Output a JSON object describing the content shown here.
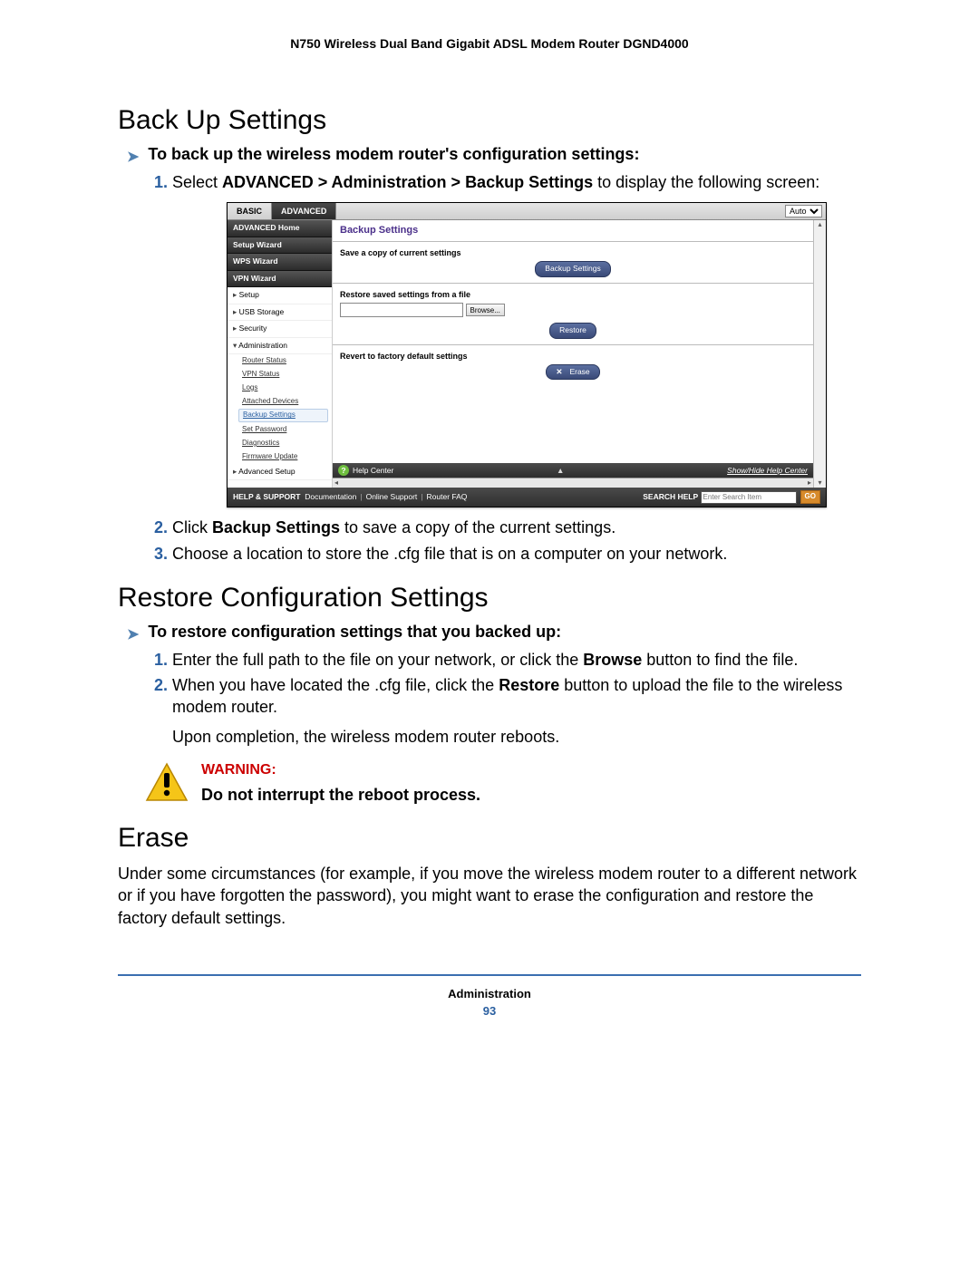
{
  "header": "N750 Wireless Dual Band Gigabit ADSL Modem Router DGND4000",
  "sections": {
    "backup": {
      "title": "Back Up Settings",
      "task": "To back up the wireless modem router's configuration settings:",
      "step1_pre": "Select ",
      "step1_bold": "ADVANCED > Administration > Backup Settings",
      "step1_post": " to display the following screen:",
      "step2_pre": "Click ",
      "step2_bold": "Backup Settings",
      "step2_post": " to save a copy of the current settings.",
      "step3": "Choose a location to store the .cfg file that is on a computer on your network."
    },
    "restore": {
      "title": "Restore Configuration Settings",
      "task": "To restore configuration settings that you backed up:",
      "step1_pre": "Enter the full path to the file on your network, or click the ",
      "step1_bold": "Browse",
      "step1_post": " button to find the file.",
      "step2_pre": "When you have located the .cfg file, click the ",
      "step2_bold": "Restore",
      "step2_post": " button to upload the file to the wireless modem router.",
      "note": "Upon completion, the wireless modem router reboots."
    },
    "erase": {
      "title": "Erase",
      "body": "Under some circumstances (for example, if you move the wireless modem router to a different network or if you have forgotten the password), you might want to erase the configuration and restore the factory default settings."
    }
  },
  "warning": {
    "label": "WARNING:",
    "msg": "Do not interrupt the reboot process."
  },
  "footer": {
    "section": "Administration",
    "page": "93"
  },
  "ui": {
    "tabs": {
      "basic": "BASIC",
      "advanced": "ADVANCED"
    },
    "language": "Auto",
    "sidebar": {
      "adv_home": "ADVANCED Home",
      "setup_wizard": "Setup Wizard",
      "wps_wizard": "WPS Wizard",
      "vpn_wizard": "VPN Wizard",
      "setup": "Setup",
      "usb": "USB Storage",
      "security": "Security",
      "admin": "Administration",
      "subs": {
        "router_status": "Router Status",
        "vpn_status": "VPN Status",
        "logs": "Logs",
        "attached": "Attached Devices",
        "backup": "Backup Settings",
        "setpw": "Set Password",
        "diag": "Diagnostics",
        "fw": "Firmware Update"
      },
      "advanced_setup": "Advanced Setup"
    },
    "main": {
      "title": "Backup Settings",
      "save_label": "Save a copy of current settings",
      "backup_btn": "Backup Settings",
      "restore_label": "Restore saved settings from a file",
      "browse_btn": "Browse...",
      "restore_btn": "Restore",
      "revert_label": "Revert to factory default settings",
      "erase_btn": "Erase"
    },
    "help_center": {
      "label": "Help Center",
      "link": "Show/Hide Help Center"
    },
    "footer_bar": {
      "help_support": "HELP & SUPPORT",
      "docs": "Documentation",
      "online": "Online Support",
      "faq": "Router FAQ",
      "search_label": "SEARCH HELP",
      "search_placeholder": "Enter Search Item",
      "go": "GO"
    }
  }
}
